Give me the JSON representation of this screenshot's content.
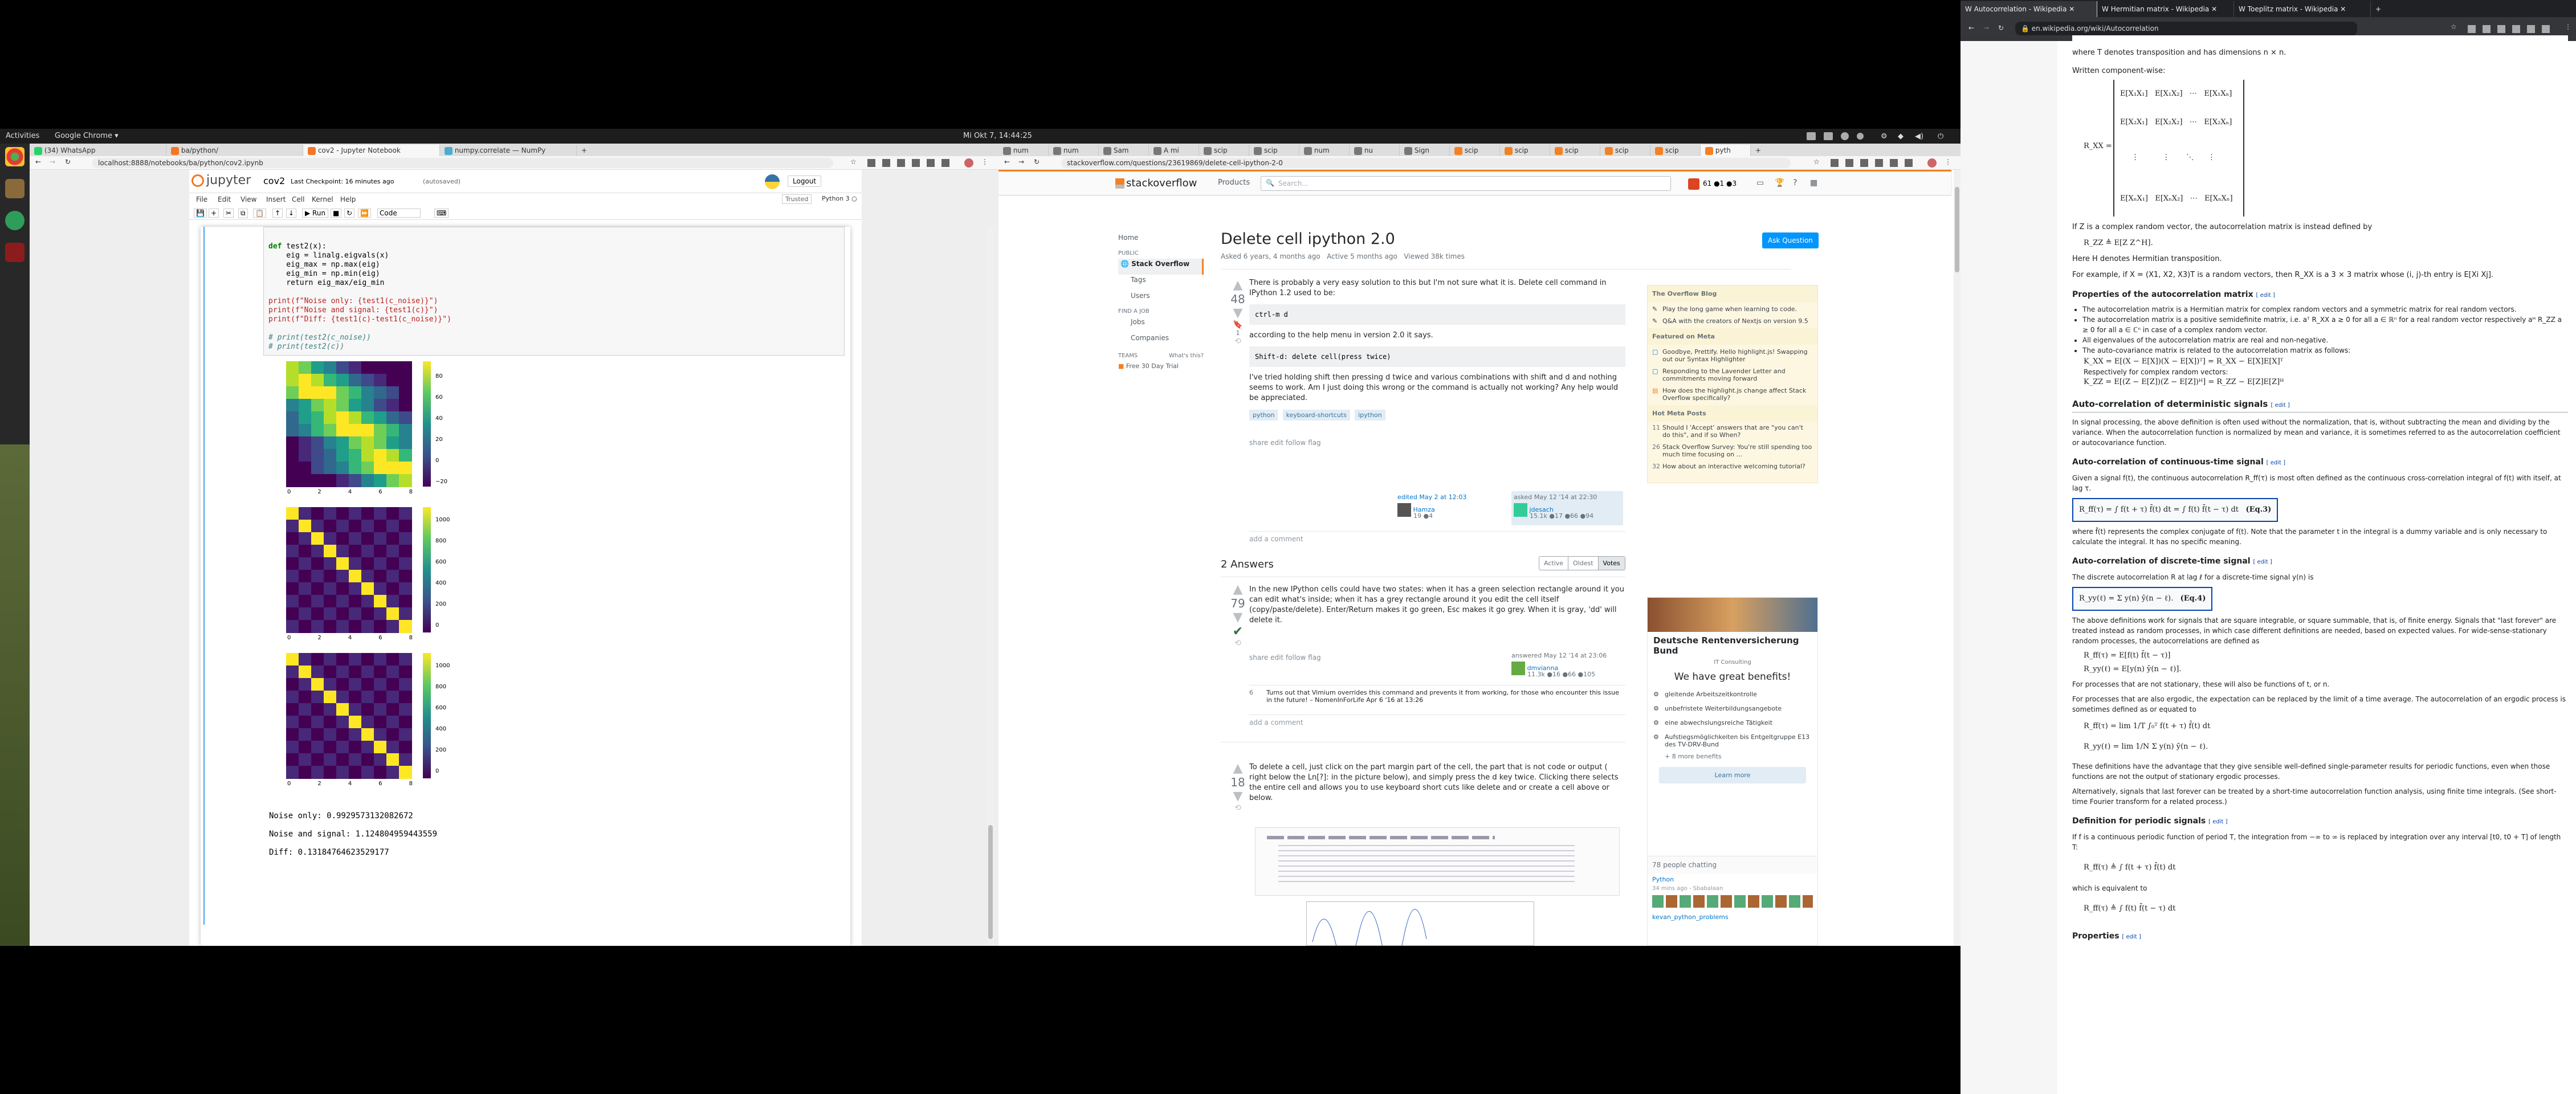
{
  "topbar": {
    "activities": "Activities",
    "app": "Google Chrome ▾",
    "clock": "Mi Okt 7, 14:44:25"
  },
  "win1": {
    "tabs": [
      "(34) WhatsApp",
      "ba/python/",
      "cov2 - Jupyter Notebook",
      "numpy.correlate — NumPy"
    ],
    "url": "localhost:8888/notebooks/ba/python/cov2.ipynb",
    "logo": "jupyter",
    "title": "cov2",
    "checkpoint": "Last Checkpoint: 16 minutes ago",
    "autosaved": "(autosaved)",
    "logout": "Logout",
    "menu": [
      "File",
      "Edit",
      "View",
      "Insert",
      "Cell",
      "Kernel",
      "Help"
    ],
    "trusted": "Trusted",
    "kernel": "Python 3 ○",
    "run": "Run",
    "celltype": "Code",
    "code": [
      "def test2(x):",
      "    eig = linalg.eigvals(x)",
      "    eig_max = np.max(eig)",
      "    eig_min = np.min(eig)",
      "    return eig_max/eig_min",
      "",
      "print(f\"Noise only: {test1(c_noise)}\")",
      "print(f\"Noise and signal: {test1(c)}\")",
      "print(f\"Diff: {test1(c)-test1(c_noise)}\")",
      "",
      "# print(test2(c_noise))",
      "# print(test2(c))"
    ],
    "hm1_ticks": [
      "0",
      "2",
      "4",
      "6",
      "8"
    ],
    "hm1_cb": [
      "80",
      "60",
      "40",
      "20",
      "0",
      "−20"
    ],
    "hm2_cb": [
      "1000",
      "800",
      "600",
      "400",
      "200",
      "0"
    ],
    "hm3_cb": [
      "1000",
      "800",
      "600",
      "400",
      "200",
      "0"
    ],
    "output": [
      "Noise only: 0.9929573132082672",
      "Noise and signal: 1.124804959443559",
      "Diff: 0.13184764623529177"
    ]
  },
  "win2": {
    "tabs": [
      "num",
      "num",
      "Sam",
      "A mi",
      "scip",
      "scip",
      "num",
      "nu",
      "Sign",
      "scip",
      "scip",
      "scip",
      "scip",
      "scip",
      "pyth"
    ],
    "url": "stackoverflow.com/questions/23619869/delete-cell-ipython-2-0",
    "logo": "stackoverflow",
    "products": "Products",
    "search": "Search...",
    "rep": "61  ●1  ●3",
    "nav": [
      "Home",
      "PUBLIC",
      "Stack Overflow",
      "Tags",
      "Users",
      "FIND A JOB",
      "Jobs",
      "Companies",
      "TEAMS",
      "What's this?",
      "Free 30 Day Trial"
    ],
    "q_title": "Delete cell ipython 2.0",
    "ask": "Ask Question",
    "q_meta": [
      "Asked 6 years, 4 months ago",
      "Active 5 months ago",
      "Viewed 38k times"
    ],
    "q_votes": "48",
    "q_bookmark": "1",
    "q_p1": "There is probably a very easy solution to this but I'm not sure what it is. Delete cell command in IPython 1.2 used to be:",
    "q_code1": "ctrl-m d",
    "q_p2": "according to the help menu in version 2.0 it says.",
    "q_code2": "Shift-d: delete cell(press twice)",
    "q_p3": "I've tried holding shift then pressing d twice and various combinations with shift and d and nothing seems to work. Am I just doing this wrong or the command is actually not working? Any help would be appreciated.",
    "q_tags": [
      "python",
      "keyboard-shortcuts",
      "ipython"
    ],
    "q_actions": "share  edit  follow  flag",
    "q_edited": "edited May 2 at 12:03",
    "q_editor": "Hamza",
    "q_editor_rep": "19 ●4",
    "q_asked": "asked May 12 '14 at 22:30",
    "q_asker": "jdesach",
    "q_asker_rep": "15.1k ●17 ●66 ●94",
    "q_addcomment": "add a comment",
    "answers_count": "2 Answers",
    "sort": [
      "Active",
      "Oldest",
      "Votes"
    ],
    "a1_votes": "79",
    "a1_text": "In the new IPython cells could have two states: when it has a green selection rectangle around it you can edit what's inside; when it has a grey rectangle around it you edit the cell itself (copy/paste/delete). Enter/Return makes it go green, Esc makes it go grey. When it is gray, 'dd' will delete it.",
    "a1_answered": "answered May 12 '14 at 23:06",
    "a1_user": "dmvianna",
    "a1_rep": "11.3k ●16 ●66 ●105",
    "a1_comment_votes": "6",
    "a1_comment": "Turns out that Vimium overrides this command and prevents it from working, for those who encounter this issue in the future! – NomenInForLife Apr 6 '16 at 13:26",
    "a2_votes": "18",
    "a2_text": "To delete a cell, just click on the part margin part of the cell, the part that is not code or output ( right below the Ln[?]: in the picture below), and simply press the d key twice. Clicking there selects the entire cell and allows you to use keyboard short cuts like delete and or create a cell above or below.",
    "blog_title": "The Overflow Blog",
    "blog_items": [
      "Play the long game when learning to code.",
      "Q&A with the creators of Nextjs on version 9.5"
    ],
    "meta_title": "Featured on Meta",
    "meta_items": [
      "Goodbye, Prettify. Hello highlight.js! Swapping out our Syntax Highlighter",
      "Responding to the Lavender Letter and commitments moving forward",
      "How does the highlight.js change affect Stack Overflow specifically?"
    ],
    "hot_title": "Hot Meta Posts",
    "hot_items": [
      [
        "11",
        "Should I 'Accept' answers that are \"you can't do this\", and if so When?"
      ],
      [
        "26",
        "Stack Overflow Survey: You're still spending too much time focusing on ..."
      ],
      [
        "32",
        "How about an interactive welcoming tutorial?"
      ]
    ],
    "ad_company": "Deutsche Rentenversicherung Bund",
    "ad_sub": "IT Consulting",
    "ad_headline": "We have great benefits!",
    "ad_items": [
      "gleitende Arbeitszeitkontrolle",
      "unbefristete Weiterbildungsangebote",
      "eine abwechslungsreiche Tätigkeit",
      "Aufstiegsmöglichkeiten bis Entgeltgruppe E13 des TV-DRV-Bund",
      "+ 8 more benefits"
    ],
    "ad_btn": "Learn more",
    "chat_title": "78 people chatting",
    "chat_room": "Python",
    "chat_time": "34 mins ago - Sbabalaan",
    "chat_room2": "kevan_python_problems"
  },
  "win3": {
    "tabs": [
      "Autocorrelation - Wikipedia",
      "Hermitian matrix - Wikipedia",
      "Toeplitz matrix - Wikipedia"
    ],
    "url": "en.wikipedia.org/wiki/Autocorrelation",
    "l1": "where T denotes transposition and has dimensions n × n.",
    "l2": "Written component-wise:",
    "matrix_lhs": "R_XX =",
    "l3": "If Z is a complex random vector, the autocorrelation matrix is instead defined by",
    "l3m": "R_ZZ ≜ E[Z Z^H].",
    "l4": "Here H denotes Hermitian transposition.",
    "l5": "For example, if X = (X1, X2, X3)T is a random vectors, then R_XX is a 3 × 3 matrix whose (i, j)-th entry is E[Xi Xj].",
    "h_props": "Properties of the autocorrelation matrix",
    "edit": "[ edit ]",
    "props": [
      "The autocorrelation matrix is a Hermitian matrix for complex random vectors and a symmetric matrix for real random vectors.",
      "The autocorrelation matrix is a positive semidefinite matrix, i.e. aᵀ R_XX a ≥ 0 for all a ∈ ℝⁿ for a real random vector respectively aᴴ R_ZZ a ≥ 0 for all a ∈ ℂⁿ in case of a complex random vector.",
      "All eigenvalues of the autocorrelation matrix are real and non-negative.",
      "The auto-covariance matrix is related to the autocorrelation matrix as follows:"
    ],
    "prop_eq1": "K_XX = E[(X − E[X])(X − E[X])ᵀ] = R_XX − E[X]E[X]ᵀ",
    "prop_l": "Respectively for complex random vectors:",
    "prop_eq2": "K_ZZ = E[(Z − E[Z])(Z − E[Z])ᴴ] = R_ZZ − E[Z]E[Z]ᴴ",
    "h_det": "Auto-correlation of deterministic signals",
    "det_p": "In signal processing, the above definition is often used without the normalization, that is, without subtracting the mean and dividing by the variance. When the autocorrelation function is normalized by mean and variance, it is sometimes referred to as the autocorrelation coefficient or autocovariance function.",
    "h_cont": "Auto-correlation of continuous-time signal",
    "cont_p": "Given a signal f(t), the continuous autocorrelation R_ff(τ) is most often defined as the continuous cross-correlation integral of f(t) with itself, at lag τ.",
    "cont_eq": "R_ff(τ) = ∫ f(t + τ) f̄(t) dt = ∫ f(t) f̄(t − τ) dt",
    "cont_eqn": "(Eq.3)",
    "cont_p2": "where f̄(t) represents the complex conjugate of f(t). Note that the parameter t in the integral is a dummy variable and is only necessary to calculate the integral. It has no specific meaning.",
    "h_disc": "Auto-correlation of discrete-time signal",
    "disc_p": "The discrete autocorrelation R at lag ℓ for a discrete-time signal y(n) is",
    "disc_eq": "R_yy(ℓ) = Σ y(n) ȳ(n − ℓ).",
    "disc_eqn": "(Eq.4)",
    "disc_p2": "The above definitions work for signals that are square integrable, or square summable, that is, of finite energy. Signals that \"last forever\" are treated instead as random processes, in which case different definitions are needed, based on expected values. For wide-sense-stationary random processes, the autocorrelations are defined as",
    "disc_e1": "R_ff(τ) = E[f(t) f̄(t − τ)]",
    "disc_e2": "R_yy(ℓ) = E[y(n) ȳ(n − ℓ)].",
    "disc_p3": "For processes that are not stationary, these will also be functions of t, or n.",
    "disc_p4": "For processes that are also ergodic, the expectation can be replaced by the limit of a time average. The autocorrelation of an ergodic process is sometimes defined as or equated to",
    "erg_e1": "R_ff(τ) = lim 1/T ∫₀ᵀ f(t + τ) f̄(t) dt",
    "erg_e2": "R_yy(ℓ) = lim 1/N Σ y(n) ȳ(n − ℓ).",
    "erg_p": "These definitions have the advantage that they give sensible well-defined single-parameter results for periodic functions, even when those functions are not the output of stationary ergodic processes.",
    "erg_p2": "Alternatively, signals that last forever can be treated by a short-time autocorrelation function analysis, using finite time integrals. (See short-time Fourier transform for a related process.)",
    "h_per": "Definition for periodic signals",
    "per_p": "If f is a continuous periodic function of period T, the integration from −∞ to ∞ is replaced by integration over any interval [t0, t0 + T] of length T:",
    "per_e1": "R_ff(τ) ≜ ∫ f(t + τ) f̄(t) dt",
    "per_l": "which is equivalent to",
    "per_e2": "R_ff(τ) ≜ ∫ f(t) f̄(t − τ) dt",
    "h_prop2": "Properties"
  }
}
